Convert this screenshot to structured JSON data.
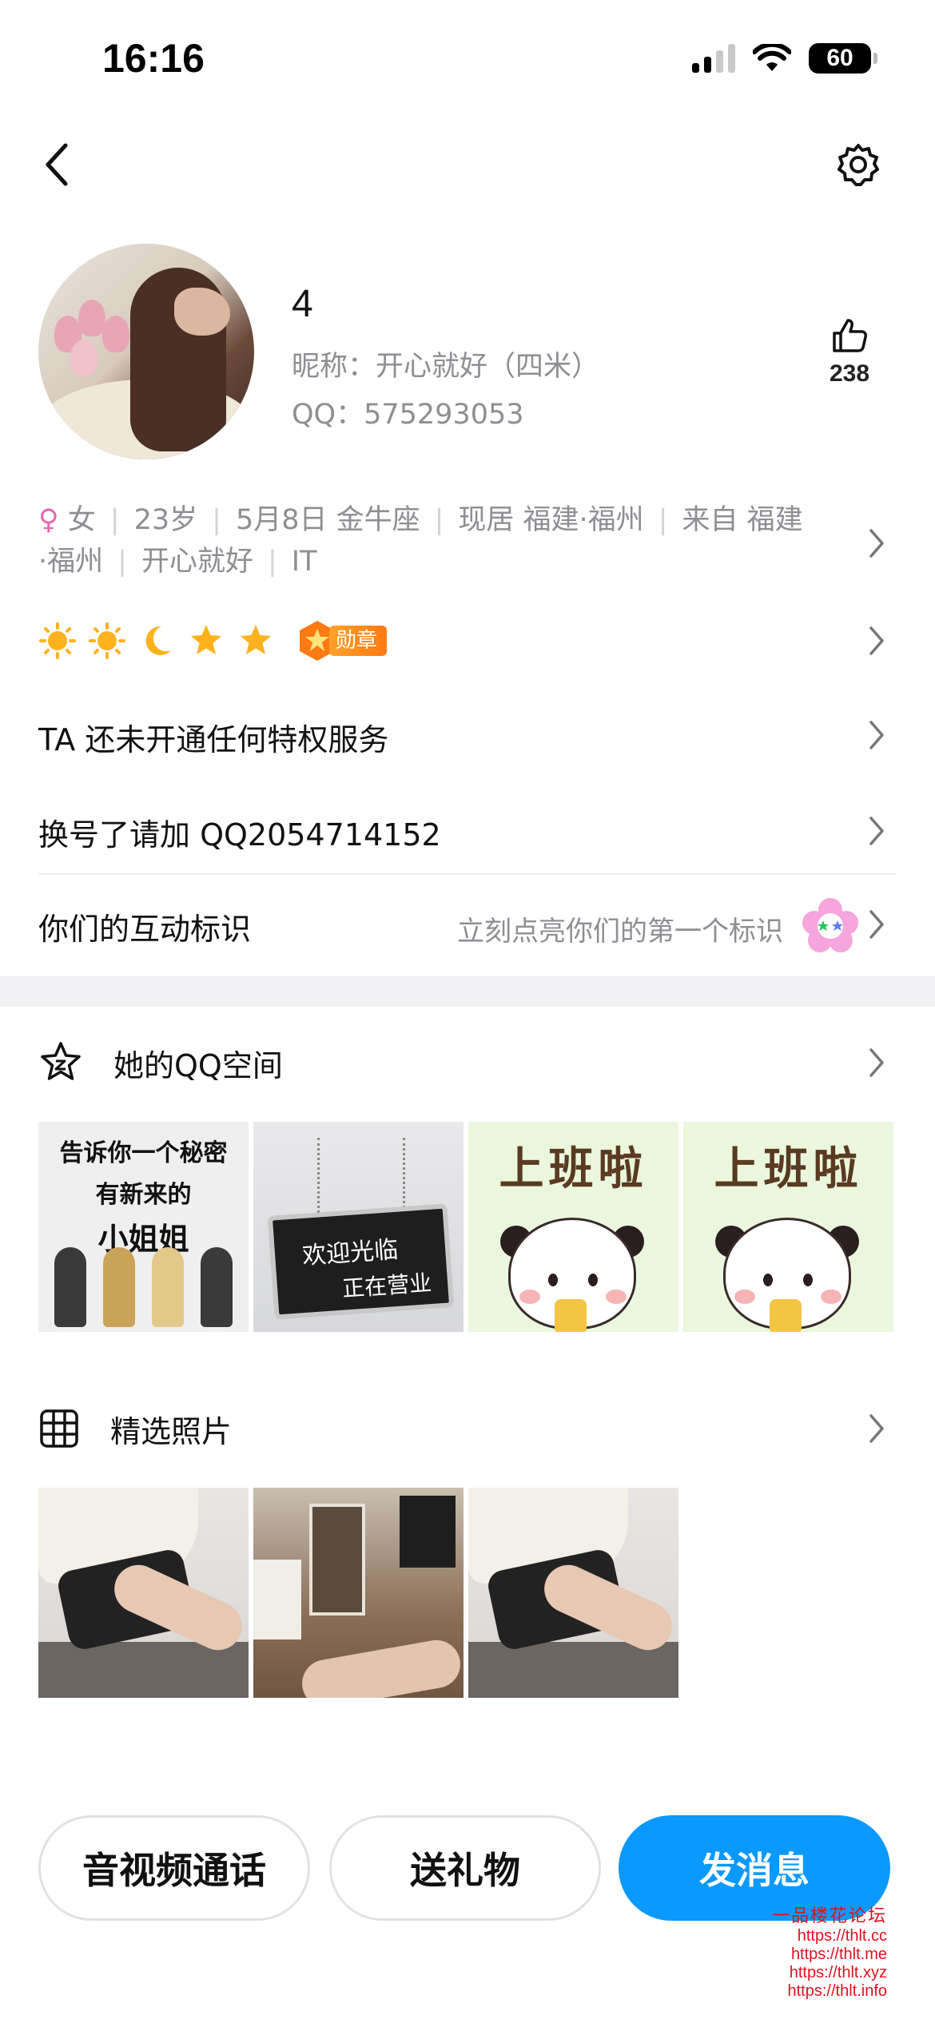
{
  "status_bar": {
    "time": "16:16",
    "battery": "60"
  },
  "profile": {
    "name": "4",
    "nickname": "昵称：开心就好（四米）",
    "qq": "QQ：575293053",
    "likes": "238"
  },
  "info_tags": {
    "gender_symbol": "♀",
    "gender": "女",
    "age": "23岁",
    "birthday": "5月8日 金牛座",
    "location_prefix": "现居 ",
    "location": "福建·福州",
    "hometown": "来自 福建·福州",
    "signature": "开心就好",
    "industry": "IT"
  },
  "badges": {
    "medal_label": "勋章"
  },
  "privilege_row": {
    "text": "TA 还未开通任何特权服务"
  },
  "status_row": {
    "text": "换号了请加 QQ2054714152"
  },
  "interaction_row": {
    "title": "你们的互动标识",
    "hint": "立刻点亮你们的第一个标识"
  },
  "qzone": {
    "title": "她的QQ空间",
    "thumbs": [
      {
        "line1": "告诉你一个秘密",
        "line2": "有新来的",
        "line3": "小姐姐"
      },
      {
        "line1": "欢迎光临",
        "line2": "正在营业"
      },
      {
        "title": "上班啦"
      },
      {
        "title": "上班啦"
      }
    ]
  },
  "photos": {
    "title": "精选照片"
  },
  "actions": {
    "call": "音视频通话",
    "gift": "送礼物",
    "message": "发消息"
  },
  "watermark": {
    "title": "一品楼花论坛",
    "urls": [
      "https://thlt.cc",
      "https://thlt.me",
      "https://thlt.xyz",
      "https://thlt.info"
    ]
  },
  "colors": {
    "accent": "#0a99ff",
    "secondary_text": "#8e8e93",
    "female": "#e36ab0",
    "watermark": "#e01020"
  }
}
